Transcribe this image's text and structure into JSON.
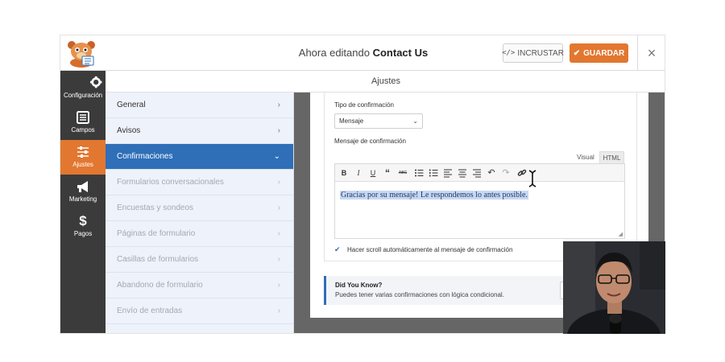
{
  "header": {
    "title_prefix": "Ahora editando",
    "form_name": "Contact Us",
    "embed_label": "INCRUSTAR",
    "save_label": "GUARDAR",
    "close_symbol": "×"
  },
  "sidebar": {
    "items": [
      {
        "label": "Configuración",
        "icon": "gear-icon"
      },
      {
        "label": "Campos",
        "icon": "form-fields-icon"
      },
      {
        "label": "Ajustes",
        "icon": "sliders-icon",
        "active": true
      },
      {
        "label": "Marketing",
        "icon": "megaphone-icon"
      },
      {
        "label": "Pagos",
        "icon": "dollar-icon"
      }
    ]
  },
  "settings": {
    "header": "Ajustes",
    "menu": [
      {
        "label": "General"
      },
      {
        "label": "Avisos"
      },
      {
        "label": "Confirmaciones",
        "active": true
      },
      {
        "label": "Formularios conversacionales",
        "disabled": true
      },
      {
        "label": "Encuestas y sondeos",
        "disabled": true
      },
      {
        "label": "Páginas de formulario",
        "disabled": true
      },
      {
        "label": "Casillas de formularios",
        "disabled": true
      },
      {
        "label": "Abandono de formulario",
        "disabled": true
      },
      {
        "label": "Envío de entradas",
        "disabled": true
      }
    ]
  },
  "confirmation": {
    "type_label": "Tipo de confirmación",
    "type_value": "Mensaje",
    "message_label": "Mensaje de confirmación",
    "tab_visual": "Visual",
    "tab_html": "HTML",
    "message_text": "Gracias por su mensaje! Le respondemos lo antes posible.",
    "scroll_label": "Hacer scroll automáticamente al mensaje de confirmación",
    "scroll_checked": true
  },
  "tip": {
    "title": "Did You Know?",
    "text": "Puedes tener varias confirmaciones con lógica condicional."
  },
  "colors": {
    "accent_orange": "#e27730",
    "active_blue": "#2f6fb8",
    "sidebar_dark": "#3b3b3b"
  }
}
